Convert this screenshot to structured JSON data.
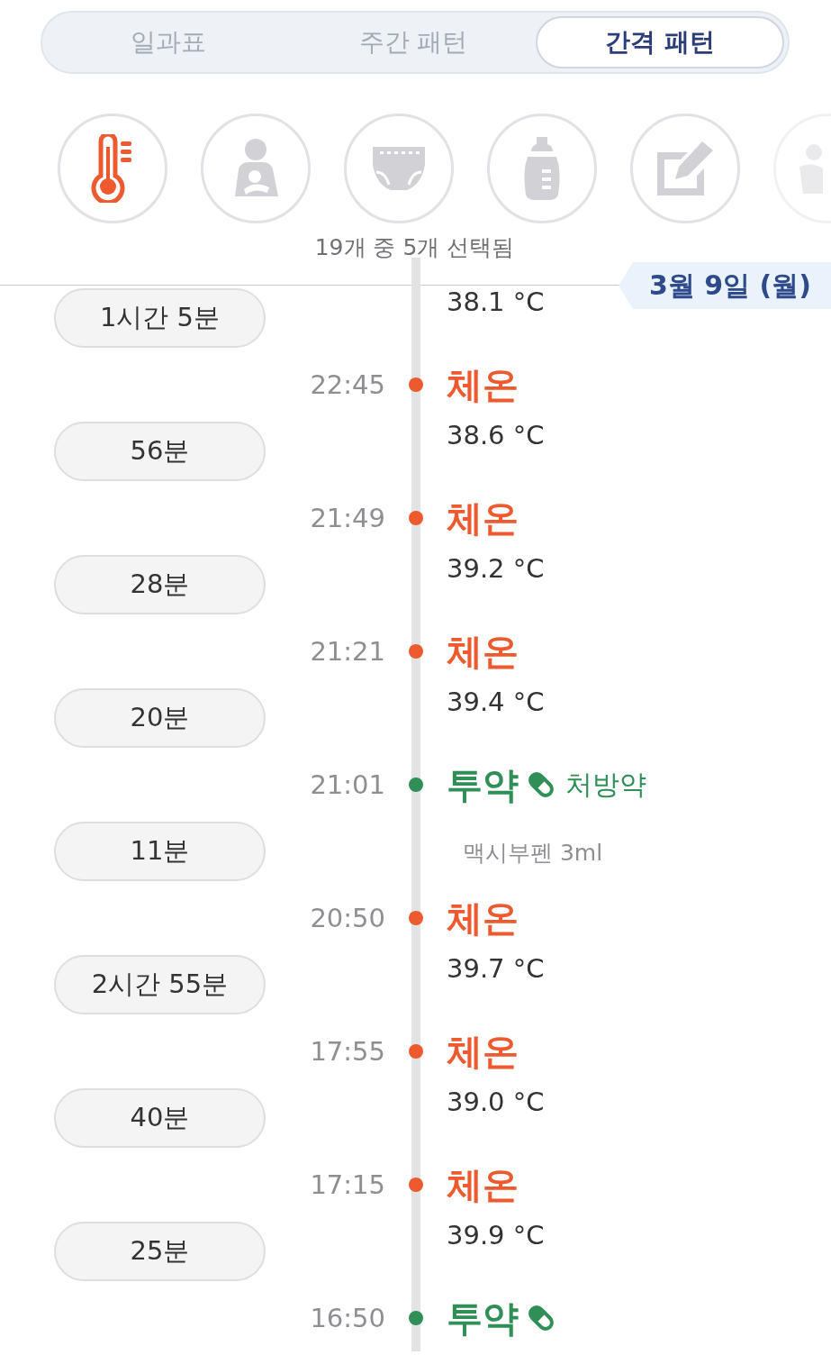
{
  "tabs": [
    {
      "label": "일과표",
      "selected": false
    },
    {
      "label": "주간 패턴",
      "selected": false
    },
    {
      "label": "간격 패턴",
      "selected": true
    }
  ],
  "categories": [
    {
      "selected": true
    },
    {
      "selected": false
    },
    {
      "selected": false
    },
    {
      "selected": false
    },
    {
      "selected": false
    },
    {
      "selected": false
    }
  ],
  "selection_summary": "19개 중 5개 선택됨",
  "date_label": "3월 9일 (월)",
  "events": [
    {
      "value": "38.1 °C",
      "gap_to_next": "1시간 5분"
    },
    {
      "kind": "temperature",
      "time": "22:45",
      "title": "체온",
      "value": "38.6 °C",
      "gap_to_next": "56분"
    },
    {
      "kind": "temperature",
      "time": "21:49",
      "title": "체온",
      "value": "39.2 °C",
      "gap_to_next": "28분"
    },
    {
      "kind": "temperature",
      "time": "21:21",
      "title": "체온",
      "value": "39.4 °C",
      "gap_to_next": "20분"
    },
    {
      "kind": "medication",
      "time": "21:01",
      "title": "투약",
      "tag": "처방약",
      "detail": "맥시부펜 3ml",
      "gap_to_next": "11분"
    },
    {
      "kind": "temperature",
      "time": "20:50",
      "title": "체온",
      "value": "39.7 °C",
      "gap_to_next": "2시간 55분"
    },
    {
      "kind": "temperature",
      "time": "17:55",
      "title": "체온",
      "value": "39.0 °C",
      "gap_to_next": "40분"
    },
    {
      "kind": "temperature",
      "time": "17:15",
      "title": "체온",
      "value": "39.9 °C",
      "gap_to_next": "25분"
    },
    {
      "kind": "medication",
      "time": "16:50",
      "title": "투약"
    }
  ]
}
